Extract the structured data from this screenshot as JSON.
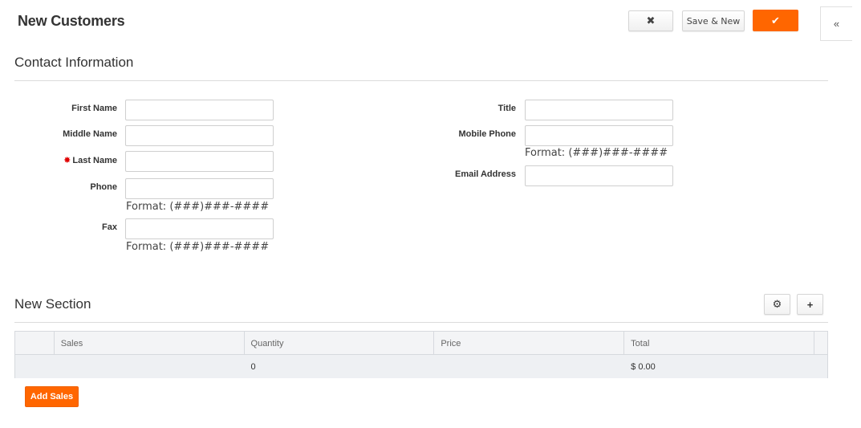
{
  "header": {
    "title": "New Customers",
    "cancel_icon": "✖",
    "save_new_label": "Save & New",
    "save_icon": "✔",
    "collapse_icon": "«"
  },
  "contact_section": {
    "title": "Contact Information",
    "fields_left": [
      {
        "label": "First Name",
        "value": "",
        "required": false
      },
      {
        "label": "Middle Name",
        "value": "",
        "required": false
      },
      {
        "label": "Last Name",
        "value": "",
        "required": true
      },
      {
        "label": "Phone",
        "value": "",
        "hint": "Format: (###)###-####"
      },
      {
        "label": "Fax",
        "value": "",
        "hint": "Format: (###)###-####"
      }
    ],
    "fields_right": [
      {
        "label": "Title",
        "value": ""
      },
      {
        "label": "Mobile Phone",
        "value": "",
        "hint": "Format: (###)###-####"
      },
      {
        "label": "Email Address",
        "value": ""
      }
    ],
    "required_marker": "✸"
  },
  "new_section": {
    "title": "New Section",
    "settings_icon": "⚙",
    "add_icon": "+",
    "table": {
      "columns": [
        "",
        "Sales",
        "Quantity",
        "Price",
        "Total"
      ],
      "rows": [
        {
          "sales": "",
          "quantity": "0",
          "price": "",
          "total": "$ 0.00"
        }
      ]
    },
    "add_button_label": "Add Sales"
  },
  "colors": {
    "accent": "#ff6600",
    "required": "#e00000"
  }
}
